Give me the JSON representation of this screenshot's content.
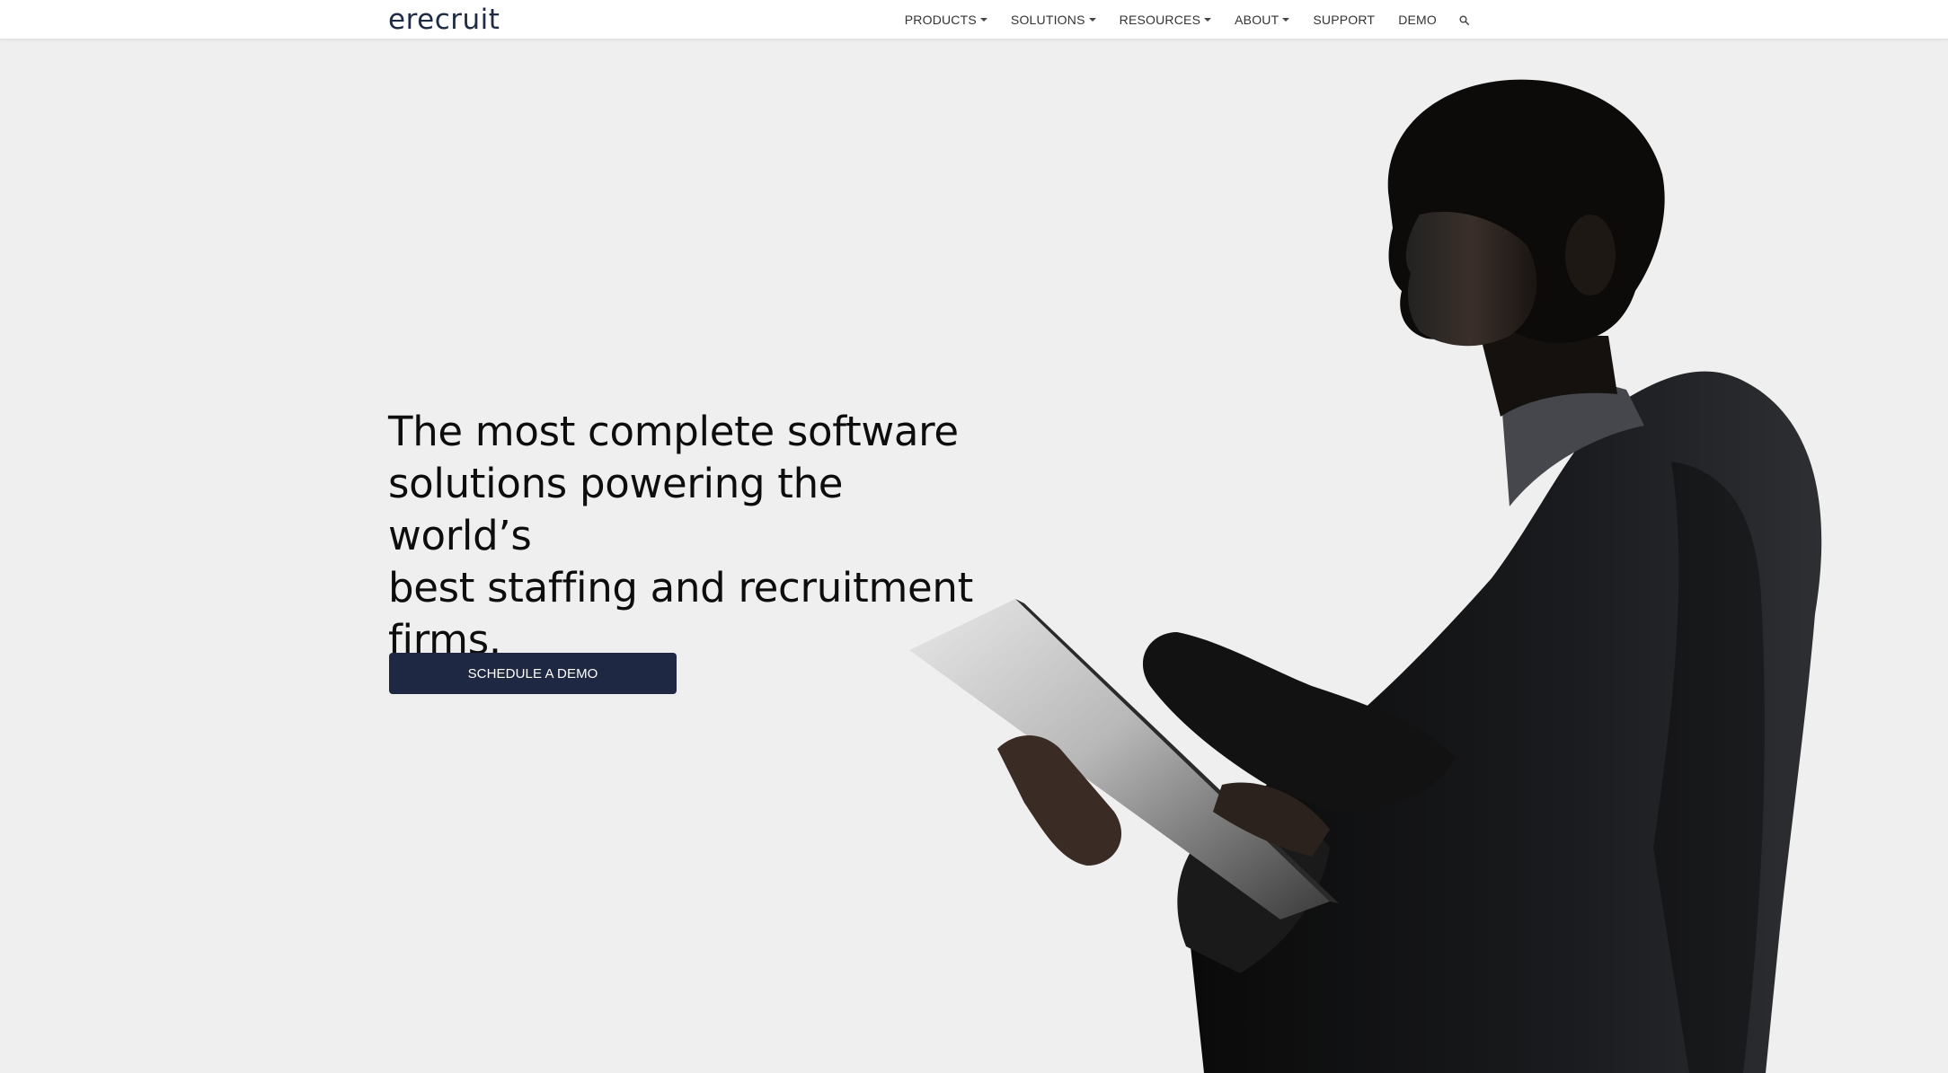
{
  "header": {
    "logo_text": "erecruit",
    "nav": [
      {
        "label": "PRODUCTS",
        "dropdown": true
      },
      {
        "label": "SOLUTIONS",
        "dropdown": true
      },
      {
        "label": "RESOURCES",
        "dropdown": true
      },
      {
        "label": "ABOUT",
        "dropdown": true
      },
      {
        "label": "SUPPORT",
        "dropdown": false
      },
      {
        "label": "DEMO",
        "dropdown": false
      }
    ],
    "search_icon": "search-icon"
  },
  "hero": {
    "headline_lines": [
      "The most complete software",
      "solutions powering the world’s",
      "best staffing and recruitment",
      "firms."
    ],
    "cta_label": "SCHEDULE A DEMO",
    "image": "man-holding-tablet-silhouette"
  },
  "colors": {
    "brand_navy": "#1f2842",
    "background": "#efefef",
    "header_bg": "#ffffff",
    "text": "#0d0d0d"
  }
}
